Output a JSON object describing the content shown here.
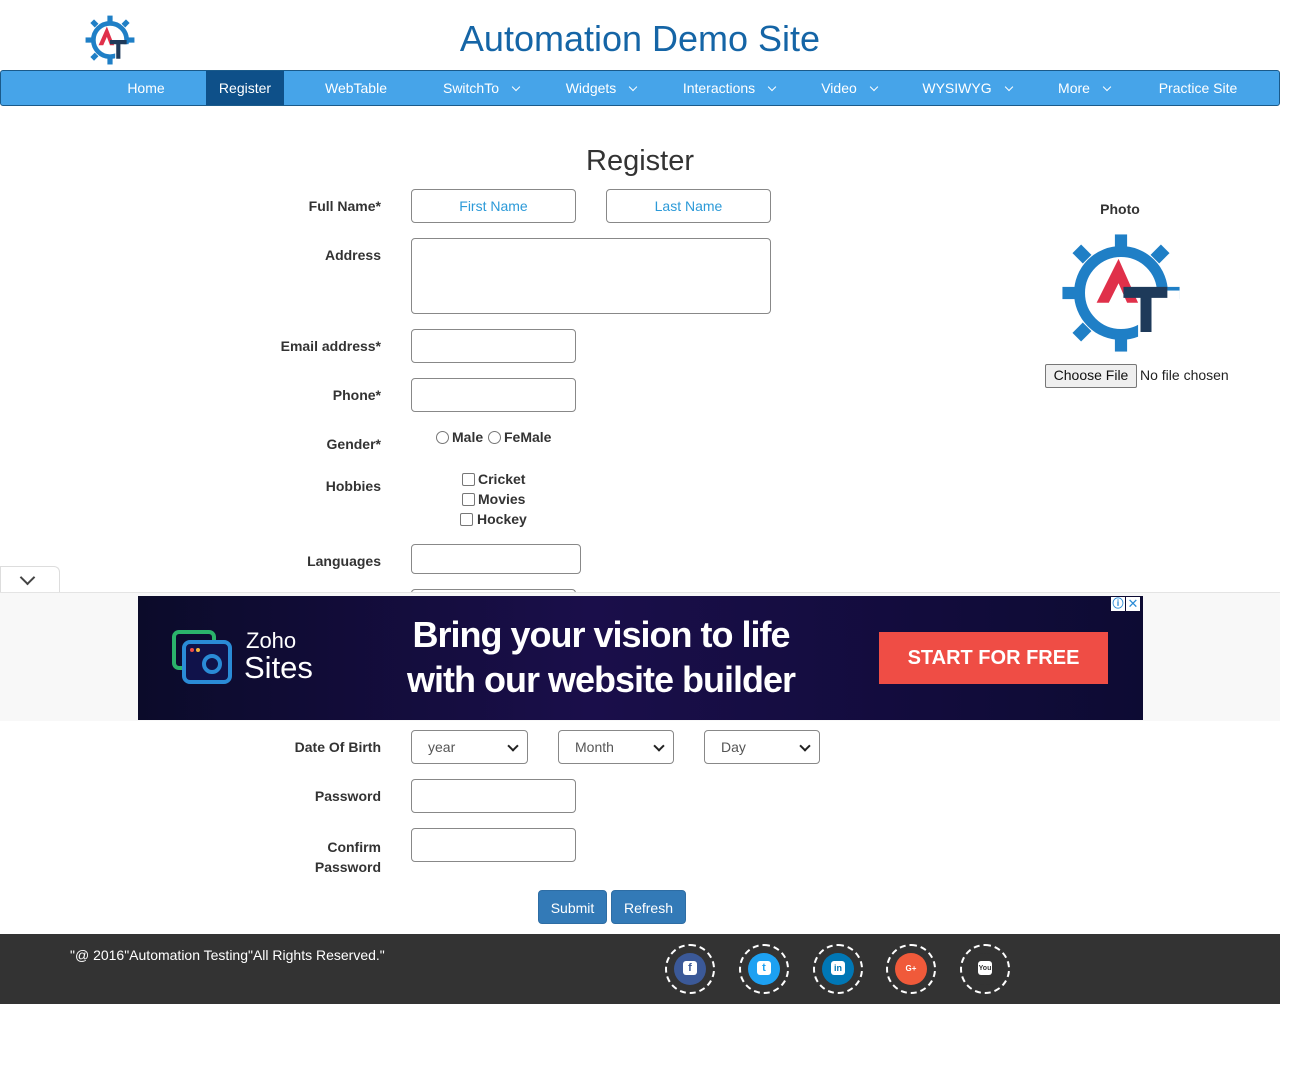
{
  "header": {
    "title": "Automation Demo Site",
    "logo_icon": "gear-at-logo"
  },
  "nav": {
    "items": [
      {
        "label": "Home"
      },
      {
        "label": "Register",
        "active": true
      },
      {
        "label": "WebTable"
      },
      {
        "label": "SwitchTo",
        "dropdown": true
      },
      {
        "label": "Widgets",
        "dropdown": true
      },
      {
        "label": "Interactions",
        "dropdown": true
      },
      {
        "label": "Video",
        "dropdown": true
      },
      {
        "label": "WYSIWYG",
        "dropdown": true
      },
      {
        "label": "More",
        "dropdown": true
      },
      {
        "label": "Practice Site"
      }
    ]
  },
  "form": {
    "title": "Register",
    "full_name_label": "Full Name*",
    "first_name_placeholder": "First Name",
    "last_name_placeholder": "Last Name",
    "address_label": "Address",
    "email_label": "Email address*",
    "phone_label": "Phone*",
    "gender_label": "Gender*",
    "gender_options": [
      "Male",
      "FeMale"
    ],
    "hobbies_label": "Hobbies",
    "hobbies_options": [
      "Cricket",
      "Movies",
      "Hockey"
    ],
    "languages_label": "Languages",
    "dob_label": "Date Of Birth",
    "dob_year": "year",
    "dob_month": "Month",
    "dob_day": "Day",
    "password_label": "Password",
    "confirm_password_label_1": "Confirm",
    "confirm_password_label_2": "Password",
    "submit_label": "Submit",
    "refresh_label": "Refresh"
  },
  "photo": {
    "label": "Photo",
    "choose_file_label": "Choose File",
    "no_file_text": "No file chosen"
  },
  "ad": {
    "brand_line1": "Zoho",
    "brand_line2": "Sites",
    "headline_1": "Bring your vision to life",
    "headline_2": "with our website builder",
    "cta": "START FOR FREE",
    "info_icon": "ⓘ",
    "close_icon": "✕"
  },
  "footer": {
    "copyright": "\"@ 2016\"Automation Testing\"All Rights Reserved.\"",
    "social": [
      {
        "name": "facebook",
        "color": "#3b5998",
        "glyph": "f"
      },
      {
        "name": "twitter",
        "color": "#1da1f2",
        "glyph": "t"
      },
      {
        "name": "linkedin",
        "color": "#0077b5",
        "glyph": "in"
      },
      {
        "name": "google-plus",
        "color": "#f05a3a",
        "glyph": "G+"
      },
      {
        "name": "youtube",
        "color": "#4a4a4a",
        "glyph": "You"
      }
    ]
  },
  "colors": {
    "nav_bg": "#46a4e9",
    "nav_active": "#0e5089",
    "title": "#1565a6",
    "button": "#337ab7",
    "footer": "#333333"
  }
}
